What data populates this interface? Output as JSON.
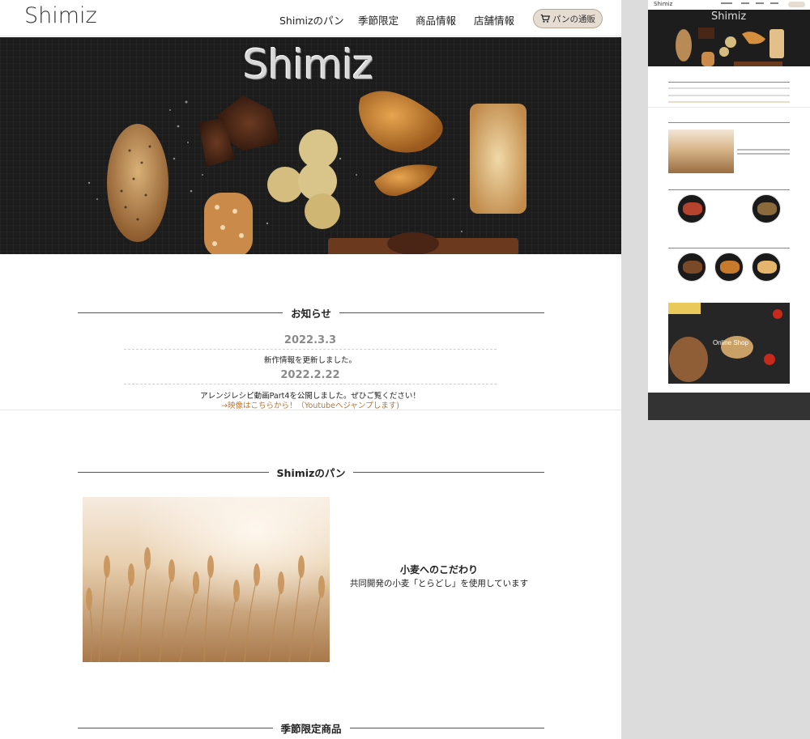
{
  "header": {
    "logo": "Shimiz",
    "nav": [
      "Shimizのパン",
      "季節限定",
      "商品情報",
      "店舗情報"
    ],
    "cart_label": "パンの通販"
  },
  "hero": {
    "title": "Shimiz"
  },
  "news": {
    "heading": "お知らせ",
    "items": [
      {
        "date": "2022.3.3",
        "text": "新作情報を更新しました。",
        "link": ""
      },
      {
        "date": "2022.2.22",
        "text": "アレンジレシピ動画Part4を公開しました。ぜひご覧ください！",
        "link": "→映像はこちらから！（Youtubeへジャンプします)"
      }
    ]
  },
  "bread": {
    "heading": "Shimizのパン",
    "feature_title": "小麦へのこだわり",
    "feature_text": "共同開発の小麦「とらどし」を使用しています"
  },
  "seasonal": {
    "heading": "季節限定商品"
  },
  "preview": {
    "logo": "Shimiz",
    "hero_title": "Shimiz",
    "shop_label": "Online Shop"
  },
  "colors": {
    "accent_link": "#b87533",
    "cart_bg": "#e6ddd2",
    "hero_bg": "#1d1d1d",
    "footer_bg": "#333333"
  }
}
